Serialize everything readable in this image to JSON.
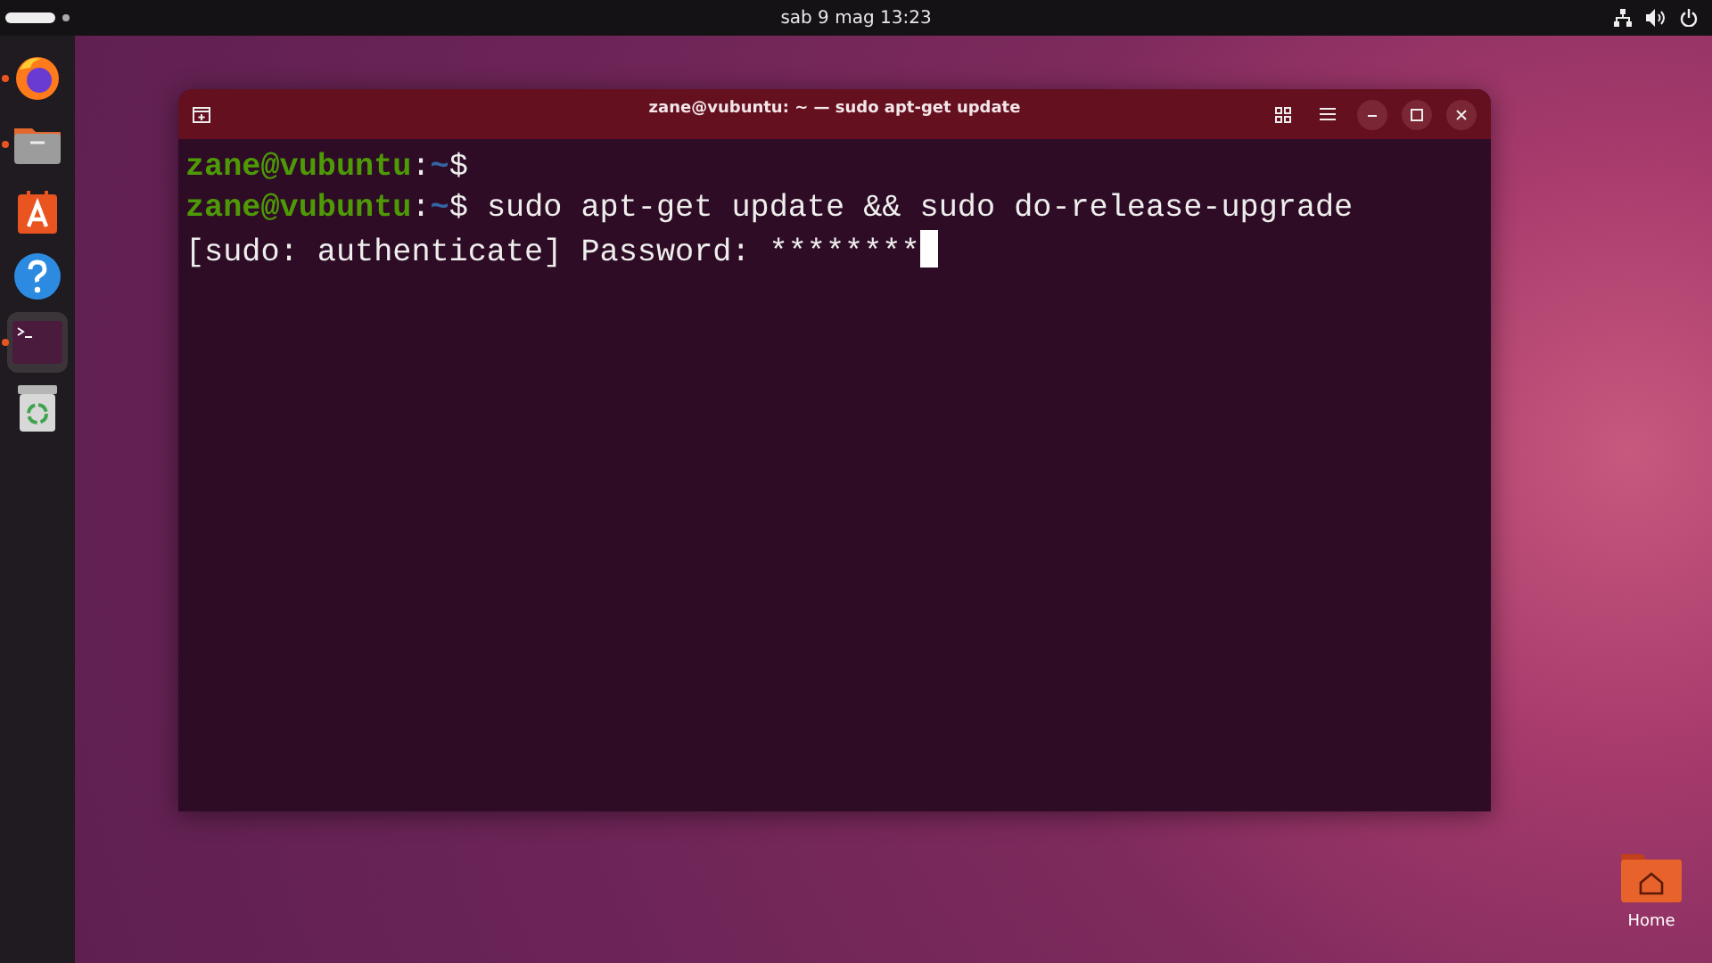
{
  "top_bar": {
    "clock": "sab 9 mag  13:23"
  },
  "dock": {
    "apps": [
      {
        "kind": "browser",
        "running": true,
        "selected": false
      },
      {
        "kind": "files",
        "running": true,
        "selected": false
      },
      {
        "kind": "store",
        "running": false,
        "selected": false
      },
      {
        "kind": "help",
        "running": false,
        "selected": false
      },
      {
        "kind": "terminal",
        "running": true,
        "selected": true
      },
      {
        "kind": "trash",
        "running": false,
        "selected": false
      }
    ]
  },
  "terminal": {
    "title": "zane@vubuntu: ~ — sudo apt-get update",
    "lines": [
      {
        "kind": "prompt",
        "user": "zane@vubuntu",
        "separator": ":",
        "path": "~",
        "symbol": "$"
      },
      {
        "kind": "prompt",
        "user": "zane@vubuntu",
        "separator": ":",
        "path": "~",
        "symbol": "$",
        "command": " sudo apt-get update && sudo do-release-upgrade"
      },
      {
        "kind": "output",
        "text": "[sudo: authenticate] Password: ********",
        "cursor": true
      }
    ]
  },
  "desktop_icons": [
    {
      "label": "Home"
    }
  ]
}
